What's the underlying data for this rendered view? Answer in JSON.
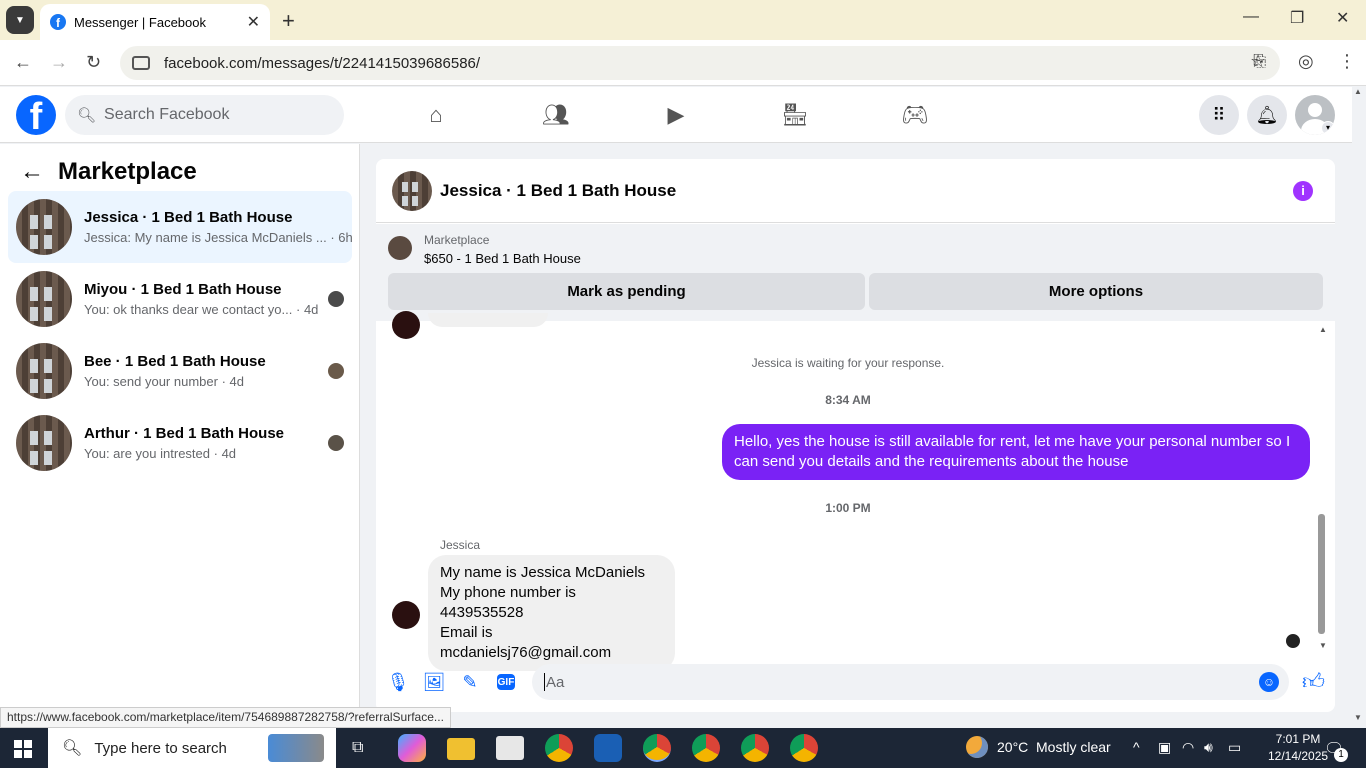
{
  "browser": {
    "tab_title": "Messenger | Facebook",
    "url": "facebook.com/messages/t/2241415039686586/"
  },
  "fb": {
    "search_placeholder": "Search Facebook"
  },
  "left": {
    "title": "Marketplace",
    "conversations": [
      {
        "name": "Jessica · 1 Bed 1 Bath House",
        "preview": "Jessica: My name is Jessica McDaniels ...",
        "time": "6h"
      },
      {
        "name": "Miyou · 1 Bed 1 Bath House",
        "preview": "You: ok thanks dear we contact yo...",
        "time": "4d"
      },
      {
        "name": "Bee · 1 Bed 1 Bath House",
        "preview": "You: send your number",
        "time": "4d"
      },
      {
        "name": "Arthur · 1 Bed 1 Bath House",
        "preview": "You: are you intrested",
        "time": "4d"
      }
    ]
  },
  "chat": {
    "title": "Jessica · 1 Bed 1 Bath House",
    "marketplace_label": "Marketplace",
    "listing": "$650 - 1 Bed 1 Bath House",
    "btn_pending": "Mark as pending",
    "btn_more": "More options",
    "system_msg": "Jessica is waiting for your response.",
    "time1": "8:34 AM",
    "outgoing": "Hello, yes the house is still available for rent, let me have your personal number so I can send you details and the requirements about the house",
    "time2": "1:00 PM",
    "sender": "Jessica",
    "incoming": [
      "My name is Jessica McDaniels",
      "My phone number is 4439535528",
      "Email is mcdanielsj76@gmail.com"
    ],
    "composer_placeholder": "Aa"
  },
  "status_url": "https://www.facebook.com/marketplace/item/754689887282758/?referralSurface...",
  "taskbar": {
    "search": "Type here to search",
    "temp": "20°C",
    "weather": "Mostly clear",
    "time": "7:01 PM",
    "date": "12/14/2025",
    "notif_count": "1"
  }
}
